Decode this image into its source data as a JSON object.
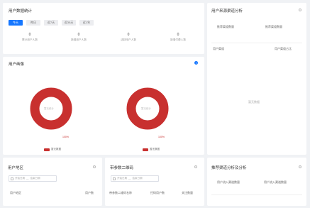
{
  "overview": {
    "title": "用户数据统计",
    "tabs": [
      "今天",
      "昨日",
      "近7天",
      "近30天",
      "近1年"
    ],
    "active_tab": 0,
    "stats": [
      {
        "value": "0",
        "label": "累计用户人数"
      },
      {
        "value": "0",
        "label": "新增用户人数"
      },
      {
        "value": "0",
        "label": "活跃用户人数"
      },
      {
        "value": "0",
        "label": "新增付费人数"
      }
    ]
  },
  "source": {
    "title": "用户来源渠道分析",
    "col_left": "推荐渠道数量",
    "col_right": "推荐渠道数量",
    "header_left": "用户渠道",
    "header_right": "用户渠道占比",
    "empty_text": "暂无数据"
  },
  "portrait": {
    "title": "用户画像",
    "info_glyph": "i",
    "donuts": [
      {
        "center": "暂无统计",
        "percent": "100%",
        "legend": "暂无数据"
      },
      {
        "center": "暂无统计",
        "percent": "100%",
        "legend": "暂无数据"
      }
    ],
    "colors": {
      "ring": "#c8302f",
      "primary": "#1677ff"
    }
  },
  "region": {
    "title": "用户地区",
    "start_placeholder": "开始日期",
    "end_placeholder": "结束日期",
    "col_left": "用户地区",
    "col_right": "用户数"
  },
  "qrcode": {
    "title": "带参数二维码",
    "start_placeholder": "开始日期",
    "end_placeholder": "结束日期",
    "col1": "带参数二维码名称",
    "col2": "扫码用户数",
    "col3": "关注数量"
  },
  "recommend": {
    "title": "推荐渠道分析及分析",
    "col_left": "用户流入渠道数量",
    "col_right": "用户流入渠道数量"
  }
}
